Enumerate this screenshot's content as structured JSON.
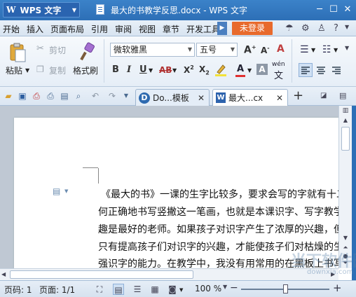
{
  "titlebar": {
    "app_name": "WPS 文字",
    "doc_title": "最大的书教学反思.docx - WPS 文字"
  },
  "menu": {
    "items": [
      "开始",
      "插入",
      "页面布局",
      "引用",
      "审阅",
      "视图",
      "章节",
      "开发工具"
    ],
    "login": "未登录"
  },
  "ribbon": {
    "paste": "粘贴",
    "cut": "剪切",
    "copy": "复制",
    "format_painter": "格式刷",
    "font_name": "微软雅黑",
    "font_size": "五号",
    "phonetic": "wén"
  },
  "tabs": [
    {
      "label": "Do...模板"
    },
    {
      "label": "最大...cx"
    }
  ],
  "document": {
    "lines": [
      "《最大的书》一课的生字比较多，要求会写的字就有十二",
      "何正确地书写竖撇这一笔画，也就是本课识字、写字教学",
      "趣是最好的老师。如果孩子对识字产生了浓厚的兴趣，但",
      "只有提高孩子们对识字的兴趣，才能使孩子们对枯燥的生",
      "强识字的能力。在教学中，我没有用常用的在黑板上书写"
    ]
  },
  "status": {
    "page": "页码: 1",
    "pages": "页面: 1/1",
    "zoom": "100 %",
    "zoom_level": 0.5
  },
  "watermark": {
    "text": "当下软件园",
    "sub": "downxia.com"
  }
}
